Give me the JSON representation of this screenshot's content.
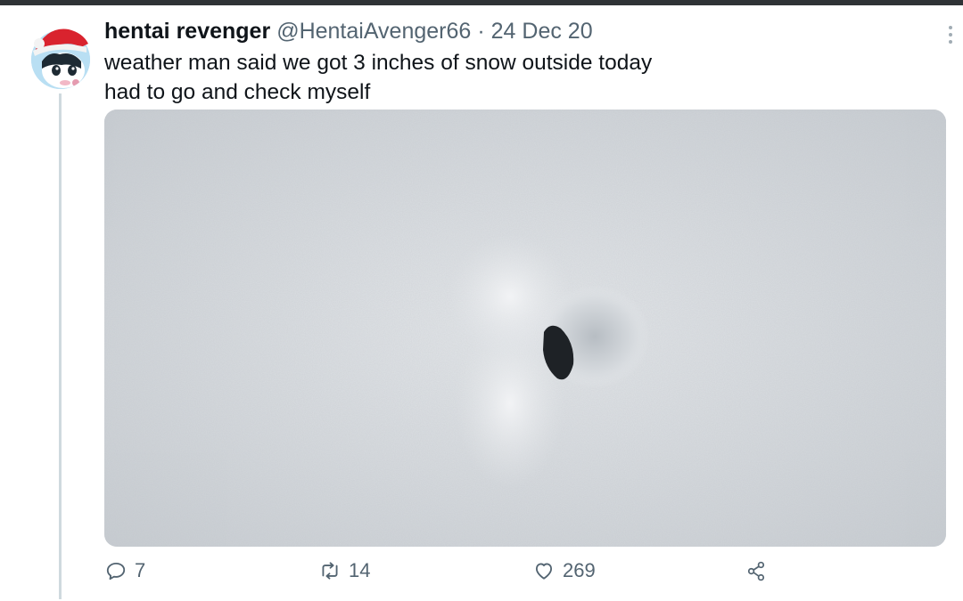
{
  "tweet": {
    "author_name": "hentai revenger",
    "author_handle": "@HentaiAvenger66",
    "separator": "·",
    "date": "24 Dec 20",
    "text_line_1": "weather man said we got 3 inches of snow outside today",
    "text_line_2": "had to go and check myself",
    "more_icon": "more-vertical-icon",
    "media_description_icon": "photo"
  },
  "actions": {
    "reply": {
      "icon": "reply-icon",
      "count": "7"
    },
    "retweet": {
      "icon": "retweet-icon",
      "count": "14"
    },
    "like": {
      "icon": "like-icon",
      "count": "269"
    },
    "share": {
      "icon": "share-icon"
    }
  },
  "colors": {
    "text": "#0f1419",
    "secondary": "#536471",
    "thread_line": "#cfd9de",
    "top_bar": "#2f3336"
  }
}
